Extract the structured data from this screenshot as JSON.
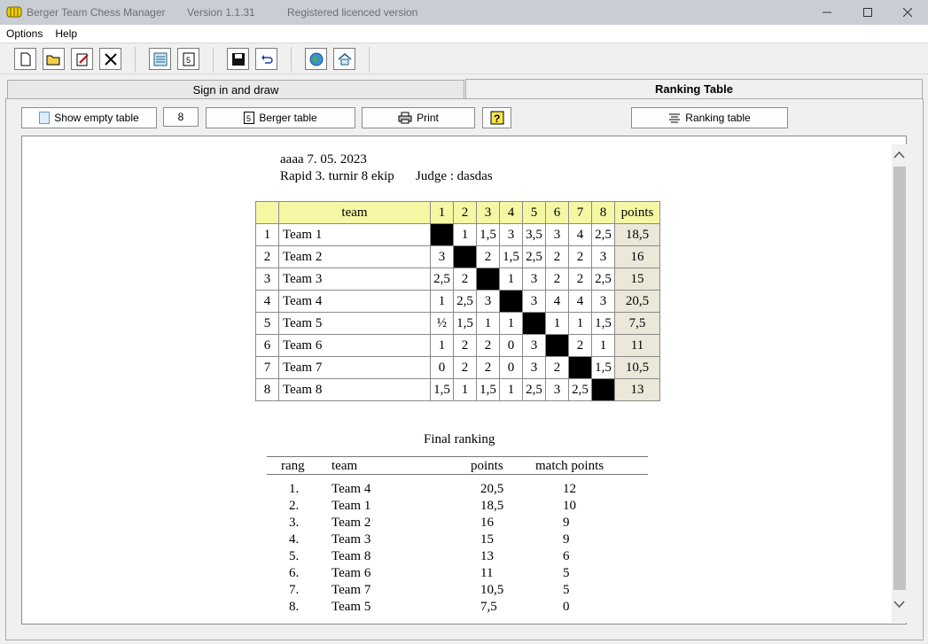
{
  "window": {
    "app_name": "Berger Team Chess Manager",
    "version": "Version 1.1.31",
    "license": "Registered licenced version"
  },
  "menu": [
    "Options",
    "Help"
  ],
  "tabs": {
    "sign_in": "Sign in and draw",
    "ranking": "Ranking Table"
  },
  "buttons": {
    "show_empty": "Show empty table",
    "teams_count": "8",
    "berger": "Berger table",
    "print": "Print",
    "ranking": "Ranking table"
  },
  "report": {
    "line1": "aaaa 7. 05. 2023",
    "line2": "Rapid 3. turnir 8 ekip",
    "judge": "Judge : dasdas"
  },
  "crosstable": {
    "team_header": "team",
    "round_headers": [
      "1",
      "2",
      "3",
      "4",
      "5",
      "6",
      "7",
      "8"
    ],
    "points_header": "points",
    "rows": [
      {
        "no": "1",
        "team": "Team 1",
        "results": [
          "",
          "1",
          "1,5",
          "3",
          "3,5",
          "3",
          "4",
          "2,5"
        ],
        "points": "18,5"
      },
      {
        "no": "2",
        "team": "Team 2",
        "results": [
          "3",
          "",
          "2",
          "1,5",
          "2,5",
          "2",
          "2",
          "3"
        ],
        "points": "16"
      },
      {
        "no": "3",
        "team": "Team 3",
        "results": [
          "2,5",
          "2",
          "",
          "1",
          "3",
          "2",
          "2",
          "2,5"
        ],
        "points": "15"
      },
      {
        "no": "4",
        "team": "Team 4",
        "results": [
          "1",
          "2,5",
          "3",
          "",
          "3",
          "4",
          "4",
          "3"
        ],
        "points": "20,5"
      },
      {
        "no": "5",
        "team": "Team 5",
        "results": [
          "½",
          "1,5",
          "1",
          "1",
          "",
          "1",
          "1",
          "1,5"
        ],
        "points": "7,5"
      },
      {
        "no": "6",
        "team": "Team 6",
        "results": [
          "1",
          "2",
          "2",
          "0",
          "3",
          "",
          "2",
          "1"
        ],
        "points": "11"
      },
      {
        "no": "7",
        "team": "Team 7",
        "results": [
          "0",
          "2",
          "2",
          "0",
          "3",
          "2",
          "",
          "1,5"
        ],
        "points": "10,5"
      },
      {
        "no": "8",
        "team": "Team 8",
        "results": [
          "1,5",
          "1",
          "1,5",
          "1",
          "2,5",
          "3",
          "2,5",
          ""
        ],
        "points": "13"
      }
    ]
  },
  "final_ranking": {
    "title": "Final ranking",
    "headers": {
      "rang": "rang",
      "team": "team",
      "points": "points",
      "match_points": "match points"
    },
    "rows": [
      {
        "rang": "1.",
        "team": "Team 4",
        "points": "20,5",
        "mp": "12"
      },
      {
        "rang": "2.",
        "team": "Team 1",
        "points": "18,5",
        "mp": "10"
      },
      {
        "rang": "3.",
        "team": "Team 2",
        "points": "16",
        "mp": "9"
      },
      {
        "rang": "4.",
        "team": "Team 3",
        "points": "15",
        "mp": "9"
      },
      {
        "rang": "5.",
        "team": "Team 8",
        "points": "13",
        "mp": "6"
      },
      {
        "rang": "6.",
        "team": "Team 6",
        "points": "11",
        "mp": "5"
      },
      {
        "rang": "7.",
        "team": "Team 7",
        "points": "10,5",
        "mp": "5"
      },
      {
        "rang": "8.",
        "team": "Team 5",
        "points": "7,5",
        "mp": "0"
      }
    ]
  }
}
